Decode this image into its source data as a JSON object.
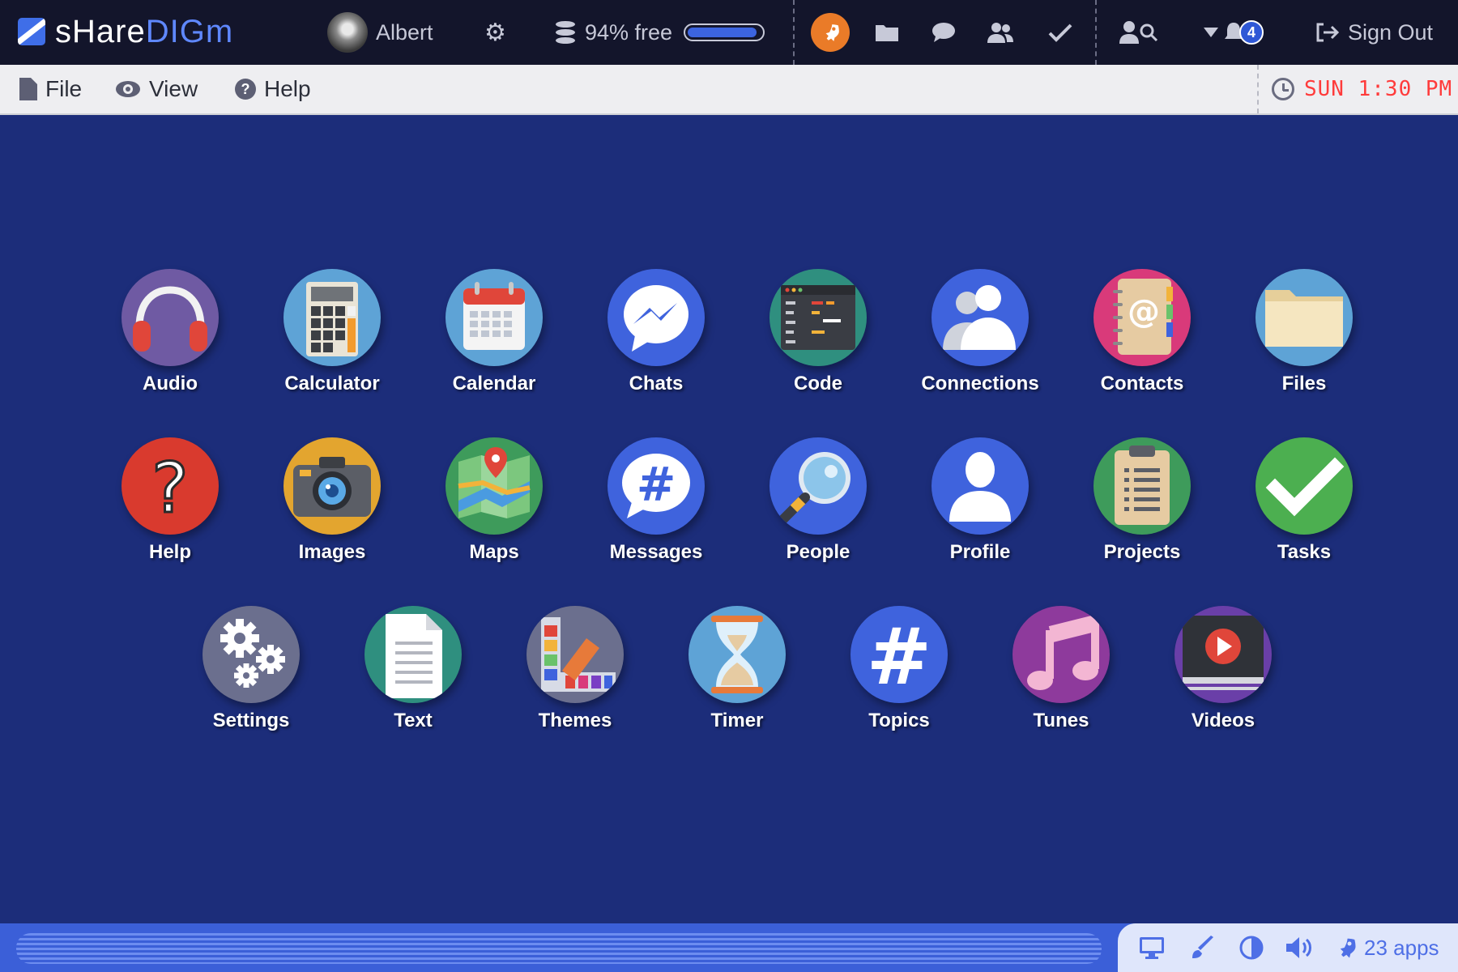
{
  "brand": {
    "part1": "sHare",
    "part2": "DIGm"
  },
  "topbar": {
    "user_name": "Albert",
    "storage_text": "94% free",
    "storage_fraction": 0.94,
    "notification_count": "4",
    "sign_out_label": "Sign Out"
  },
  "menu": {
    "file": "File",
    "view": "View",
    "help": "Help",
    "clock": "SUN 1:30 PM"
  },
  "apps": [
    {
      "label": "Audio"
    },
    {
      "label": "Calculator"
    },
    {
      "label": "Calendar"
    },
    {
      "label": "Chats"
    },
    {
      "label": "Code"
    },
    {
      "label": "Connections"
    },
    {
      "label": "Contacts"
    },
    {
      "label": "Files"
    },
    {
      "label": "Help"
    },
    {
      "label": "Images"
    },
    {
      "label": "Maps"
    },
    {
      "label": "Messages"
    },
    {
      "label": "People"
    },
    {
      "label": "Profile"
    },
    {
      "label": "Projects"
    },
    {
      "label": "Tasks"
    },
    {
      "label": "Settings"
    },
    {
      "label": "Text"
    },
    {
      "label": "Themes"
    },
    {
      "label": "Timer"
    },
    {
      "label": "Topics"
    },
    {
      "label": "Tunes"
    },
    {
      "label": "Videos"
    }
  ],
  "taskbar": {
    "apps_count_label": "23 apps"
  },
  "colors": {
    "desktop_bg": "#1c2d7a",
    "topbar_bg": "#13152b",
    "accent": "#3c64e0",
    "clock_red": "#ff3b3b",
    "rocket_orange": "#ea7b28"
  }
}
